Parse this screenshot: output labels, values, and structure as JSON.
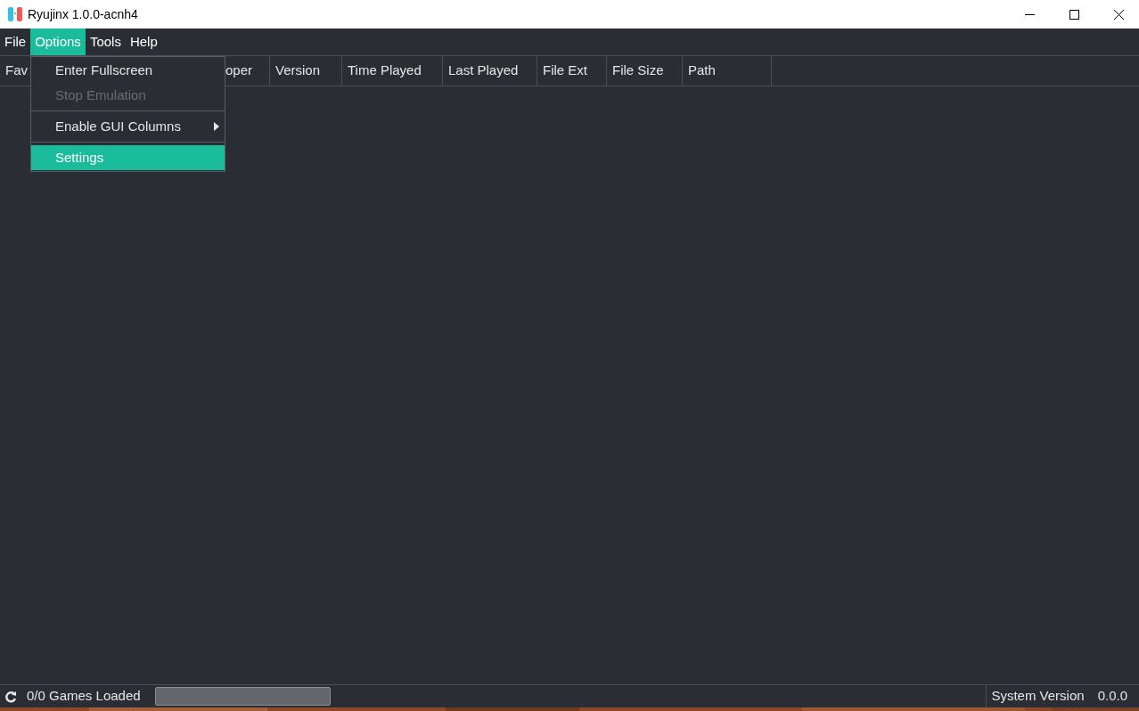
{
  "window": {
    "title": "Ryujinx 1.0.0-acnh4"
  },
  "menu_bar": [
    {
      "label": "File",
      "selected": false
    },
    {
      "label": "Options",
      "selected": true
    },
    {
      "label": "Tools",
      "selected": false
    },
    {
      "label": "Help",
      "selected": false
    }
  ],
  "open_menu": {
    "items": [
      {
        "kind": "item",
        "label": "Enter Fullscreen",
        "disabled": false,
        "selected": false
      },
      {
        "kind": "item",
        "label": "Stop Emulation",
        "disabled": true,
        "selected": false
      },
      {
        "kind": "separator"
      },
      {
        "kind": "submenu",
        "label": "Enable GUI Columns",
        "disabled": false,
        "selected": false
      },
      {
        "kind": "separator"
      },
      {
        "kind": "item",
        "label": "Settings",
        "disabled": false,
        "selected": true
      }
    ]
  },
  "table": {
    "columns": [
      "Fav",
      "oper",
      "Version",
      "Time Played",
      "Last Played",
      "File Ext",
      "File Size",
      "Path"
    ]
  },
  "status_bar": {
    "games_loaded": "0/0 Games Loaded",
    "progress": {
      "level": 0
    },
    "system_version_label": "System Version",
    "system_version": "0.0.0"
  }
}
